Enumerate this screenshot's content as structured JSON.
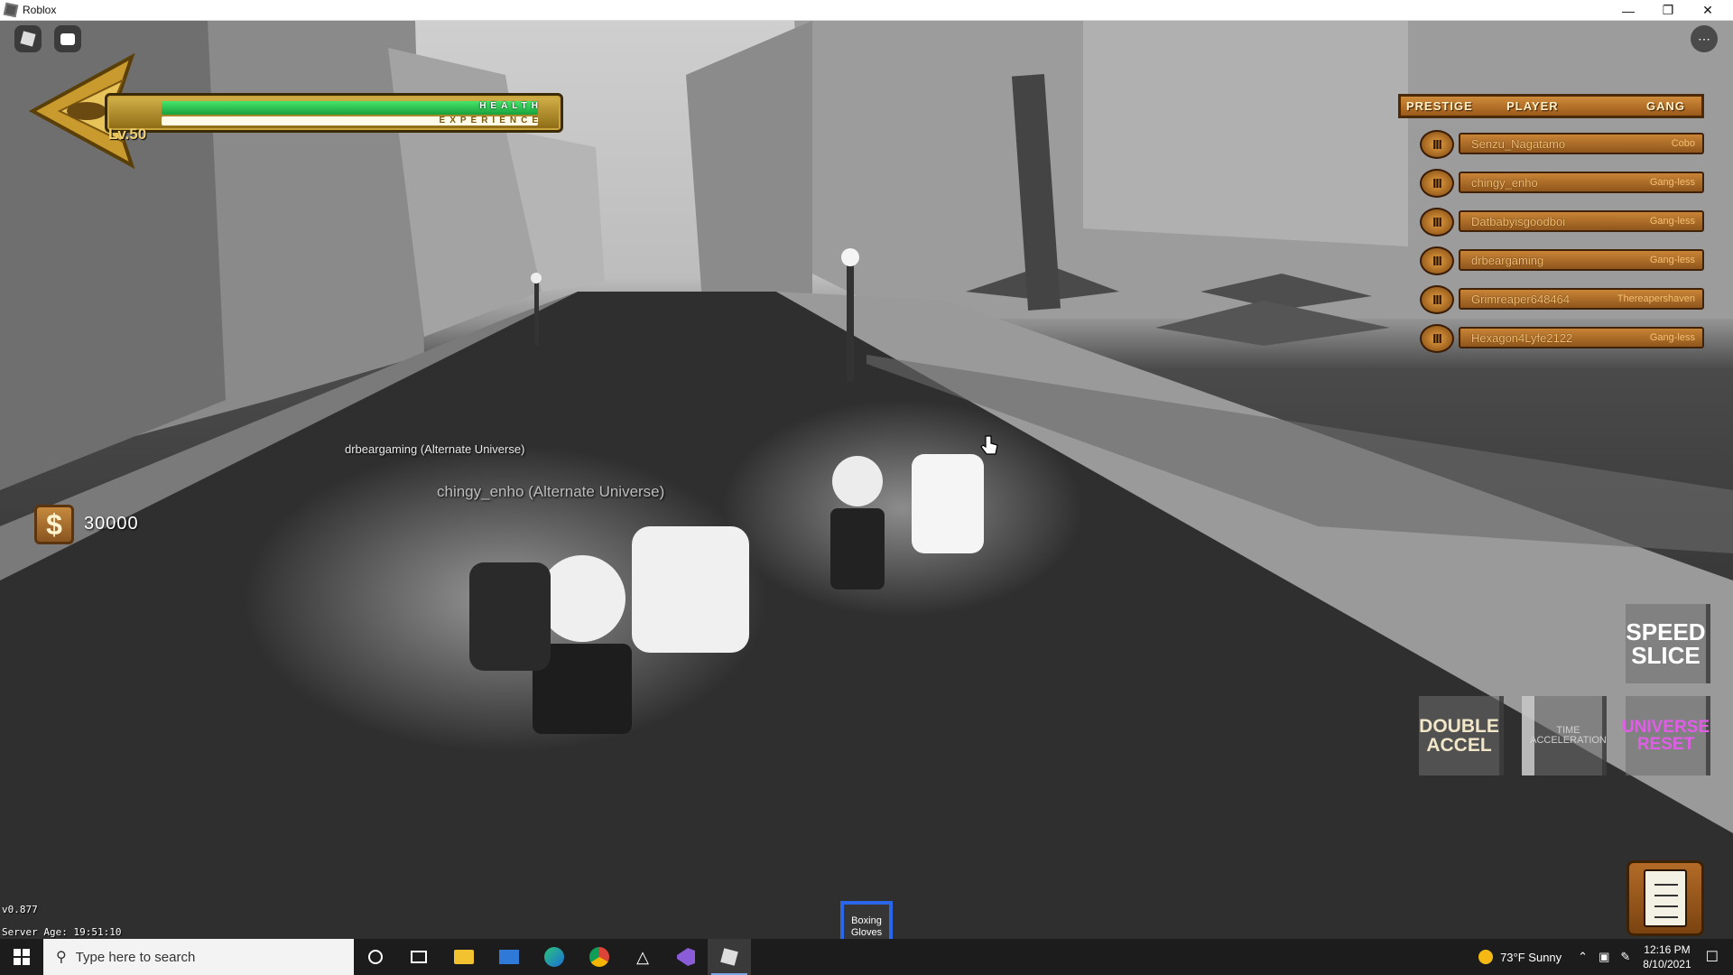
{
  "window": {
    "title": "Roblox"
  },
  "hud": {
    "level": "Lv.50",
    "health_label": "HEALTH",
    "experience_label": "EXPERIENCE",
    "health_fraction": 0.97,
    "experience_fraction": 0.97,
    "money": "30000",
    "version": "v0.877",
    "server_age": "Server Age: 19:51:10"
  },
  "leaderboard": {
    "headers": {
      "prestige": "PRESTIGE",
      "player": "PLAYER",
      "gang": "GANG"
    },
    "rows": [
      {
        "prestige": "III",
        "player": "Senzu_Nagatamo",
        "gang": "Cobo"
      },
      {
        "prestige": "III",
        "player": "chingy_enho",
        "gang": "Gang-less"
      },
      {
        "prestige": "III",
        "player": "Datbabyisgoodboi",
        "gang": "Gang-less"
      },
      {
        "prestige": "III",
        "player": "drbeargaming",
        "gang": "Gang-less"
      },
      {
        "prestige": "III",
        "player": "Grimreaper648464",
        "gang": "Thereapershaven"
      },
      {
        "prestige": "III",
        "player": "Hexagon4Lyfe2122",
        "gang": "Gang-less"
      }
    ]
  },
  "abilities": {
    "speed_slice": "SPEED SLICE",
    "double_accel": "DOUBLE ACCEL",
    "time_acceleration": "TIME ACCELERATION",
    "universe_reset": "UNIVERSE RESET"
  },
  "hotbar": {
    "slot1": "Boxing Gloves"
  },
  "overhead_names": {
    "drbeargaming": "drbeargaming (Alternate Universe)",
    "chingy": "chingy_enho (Alternate Universe)"
  },
  "taskbar": {
    "search_placeholder": "Type here to search",
    "weather": "73°F  Sunny",
    "time": "12:16 PM",
    "date": "8/10/2021"
  },
  "colors": {
    "health": "#1fb84a",
    "leaderboard_wood": "#b87430",
    "hotbar_border": "#2a66e8",
    "universe_reset": "#e15de8"
  }
}
